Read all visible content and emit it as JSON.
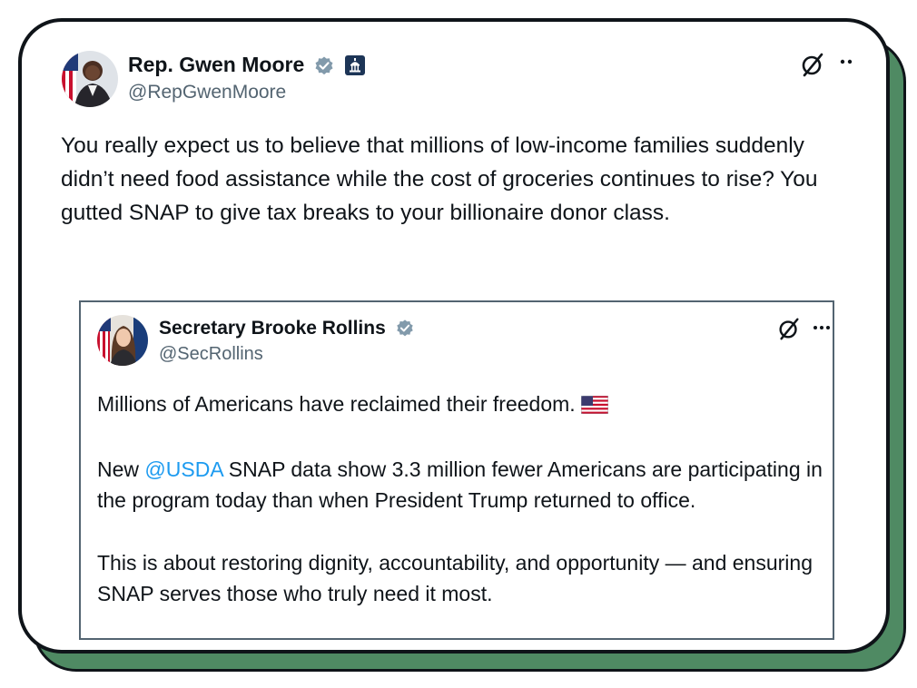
{
  "colors": {
    "accent_green": "#4f8a63",
    "verified_badge": "#829aab",
    "mention_blue": "#1d9bf0",
    "text_primary": "#0f1419",
    "text_secondary": "#536471"
  },
  "post": {
    "author_name": "Rep. Gwen Moore",
    "author_handle": "@RepGwenMoore",
    "verified_icon": "verified-badge-icon",
    "affiliation_icon": "capitol-building-icon",
    "menu_icon": "more-options-icon",
    "grok_icon": "grok-icon",
    "text": "You really expect us to believe that millions of low-income families suddenly didn’t need food assistance while the cost of groceries continues to rise? You gutted SNAP to give tax breaks to your billionaire donor class."
  },
  "quoted_post": {
    "author_name": "Secretary Brooke Rollins",
    "author_handle": "@SecRollins",
    "verified_icon": "verified-badge-icon",
    "paragraph1": "Millions of Americans have reclaimed their freedom.",
    "flag_emoji": "us-flag-icon",
    "paragraph2_prefix": "New ",
    "paragraph2_mention": "@USDA",
    "paragraph2_suffix": " SNAP data show 3.3 million fewer Americans are participating in the program today than when President Trump returned to office.",
    "paragraph3": "This is about restoring dignity, accountability, and opportunity — and ensuring SNAP serves those who truly need it most."
  }
}
